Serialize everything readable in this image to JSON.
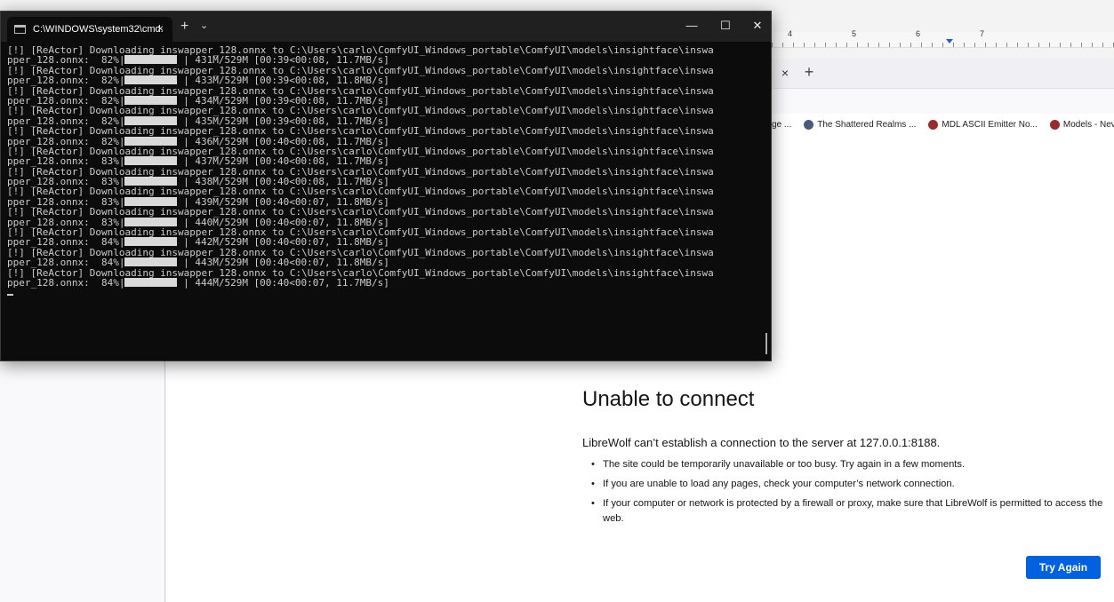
{
  "browser": {
    "ruler_numbers": [
      "4",
      "5",
      "6",
      "7"
    ],
    "tab_close": "×",
    "tab_new": "+",
    "bookmarks": [
      {
        "label": "ge ...",
        "icon": "none"
      },
      {
        "label": "The Shattered Realms ...",
        "icon": "globe-icon"
      },
      {
        "label": "MDL ASCII Emitter No...",
        "icon": "neverwinter-icon"
      },
      {
        "label": "Models - Neverwinter ...",
        "icon": "neverwinter-icon"
      }
    ],
    "error": {
      "title": "Unable to connect",
      "description": "LibreWolf can’t establish a connection to the server at 127.0.0.1:8188.",
      "bullets": [
        "The site could be temporarily unavailable or too busy. Try again in a few moments.",
        "If you are unable to load any pages, check your computer’s network connection.",
        "If your computer or network is protected by a firewall or proxy, make sure that LibreWolf is permitted to access the web."
      ],
      "button": "Try Again"
    }
  },
  "terminal": {
    "tab_title": "C:\\WINDOWS\\system32\\cmd.",
    "tab_close": "×",
    "new_tab": "+",
    "dropdown": "⌄",
    "minimize": "—",
    "maximize": "☐",
    "close": "✕",
    "download_prefix": "[!] [ReActor] Downloading inswapper_128.onnx to C:\\Users\\carlo\\ComfyUI_Windows_portable\\ComfyUI\\models\\insightface\\inswa",
    "progress_lines": [
      {
        "percent": "82%",
        "stats": "431M/529M [00:39<00:08, 11.7MB/s]",
        "fill": 0.82
      },
      {
        "percent": "82%",
        "stats": "433M/529M [00:39<00:08, 11.8MB/s]",
        "fill": 0.82
      },
      {
        "percent": "82%",
        "stats": "434M/529M [00:39<00:08, 11.7MB/s]",
        "fill": 0.82
      },
      {
        "percent": "82%",
        "stats": "435M/529M [00:39<00:08, 11.7MB/s]",
        "fill": 0.82
      },
      {
        "percent": "82%",
        "stats": "436M/529M [00:40<00:08, 11.7MB/s]",
        "fill": 0.82
      },
      {
        "percent": "83%",
        "stats": "437M/529M [00:40<00:08, 11.7MB/s]",
        "fill": 0.83
      },
      {
        "percent": "83%",
        "stats": "438M/529M [00:40<00:08, 11.7MB/s]",
        "fill": 0.83
      },
      {
        "percent": "83%",
        "stats": "439M/529M [00:40<00:07, 11.8MB/s]",
        "fill": 0.83
      },
      {
        "percent": "83%",
        "stats": "440M/529M [00:40<00:07, 11.8MB/s]",
        "fill": 0.83
      },
      {
        "percent": "84%",
        "stats": "442M/529M [00:40<00:07, 11.8MB/s]",
        "fill": 0.84
      },
      {
        "percent": "84%",
        "stats": "443M/529M [00:40<00:07, 11.8MB/s]",
        "fill": 0.84
      },
      {
        "percent": "84%",
        "stats": "444M/529M [00:40<00:07, 11.7MB/s]",
        "fill": 0.84
      }
    ],
    "line_start": "pper_128.onnx:  "
  }
}
